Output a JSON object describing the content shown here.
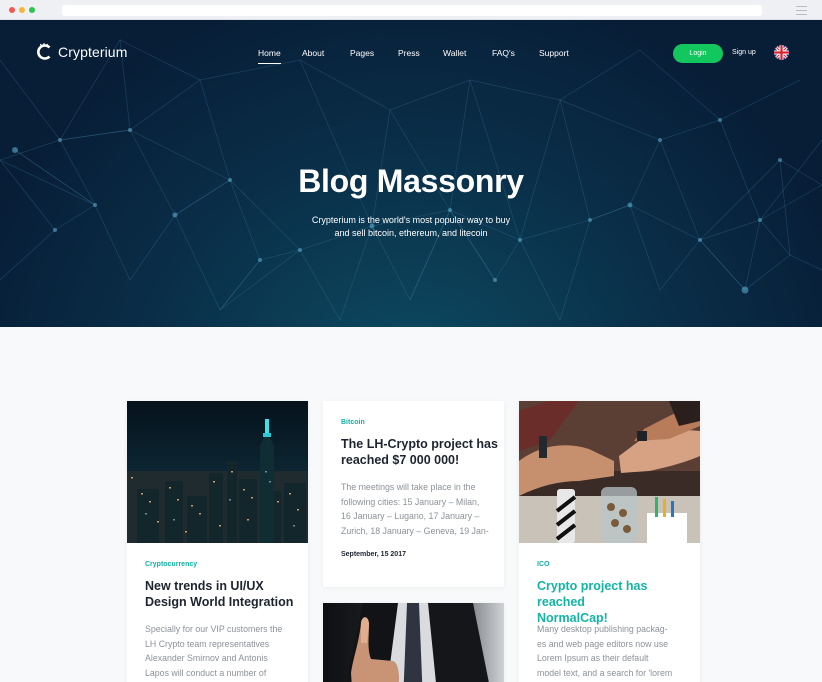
{
  "brand": {
    "name": "Crypterium"
  },
  "nav": {
    "items": [
      {
        "label": "Home",
        "active": true
      },
      {
        "label": "About",
        "active": false
      },
      {
        "label": "Pages",
        "active": false
      },
      {
        "label": "Press",
        "active": false
      },
      {
        "label": "Wallet",
        "active": false
      },
      {
        "label": "FAQ's",
        "active": false
      },
      {
        "label": "Support",
        "active": false
      }
    ],
    "login_label": "Login",
    "signup_label": "Sign up",
    "language_icon": "uk-flag-icon"
  },
  "hero": {
    "title": "Blog Massonry",
    "subtitle_line1": "Crypterium is the world's most popular way to buy",
    "subtitle_line2": "and sell bitcoin, ethereum, and litecoin"
  },
  "posts": [
    {
      "tag": "Cryptocurrency",
      "title_line1": "New trends in UI/UX",
      "title_line2": "Design World Integration",
      "excerpt": [
        "Specially for our VIP customers the",
        "LH Crypto team representatives",
        "Alexander Smirnov and Antonis",
        "Lapos will conduct a number of"
      ]
    },
    {
      "tag": "Bitcoin",
      "title_line1": "The LH-Crypto project has",
      "title_line2": "reached $7 000 000!",
      "excerpt": [
        "The meetings will take place in the",
        "following cities: 15 January – Milan,",
        "16 January – Lugano, 17 January –",
        "Zurich, 18 January – Geneva, 19 Jan-"
      ],
      "date": "September, 15 2017"
    },
    {
      "tag": "ICO",
      "title_line1": "Crypto project has reached",
      "title_line2": "NormalCap!",
      "excerpt": [
        "Many desktop publishing packag-",
        "es and web page editors now use",
        "Lorem Ipsum as their default",
        "model text, and a search for 'lorem"
      ]
    }
  ],
  "colors": {
    "accent_green": "#13c75f",
    "tag_teal": "#10b0a4",
    "hero_bg": "#081d36"
  }
}
